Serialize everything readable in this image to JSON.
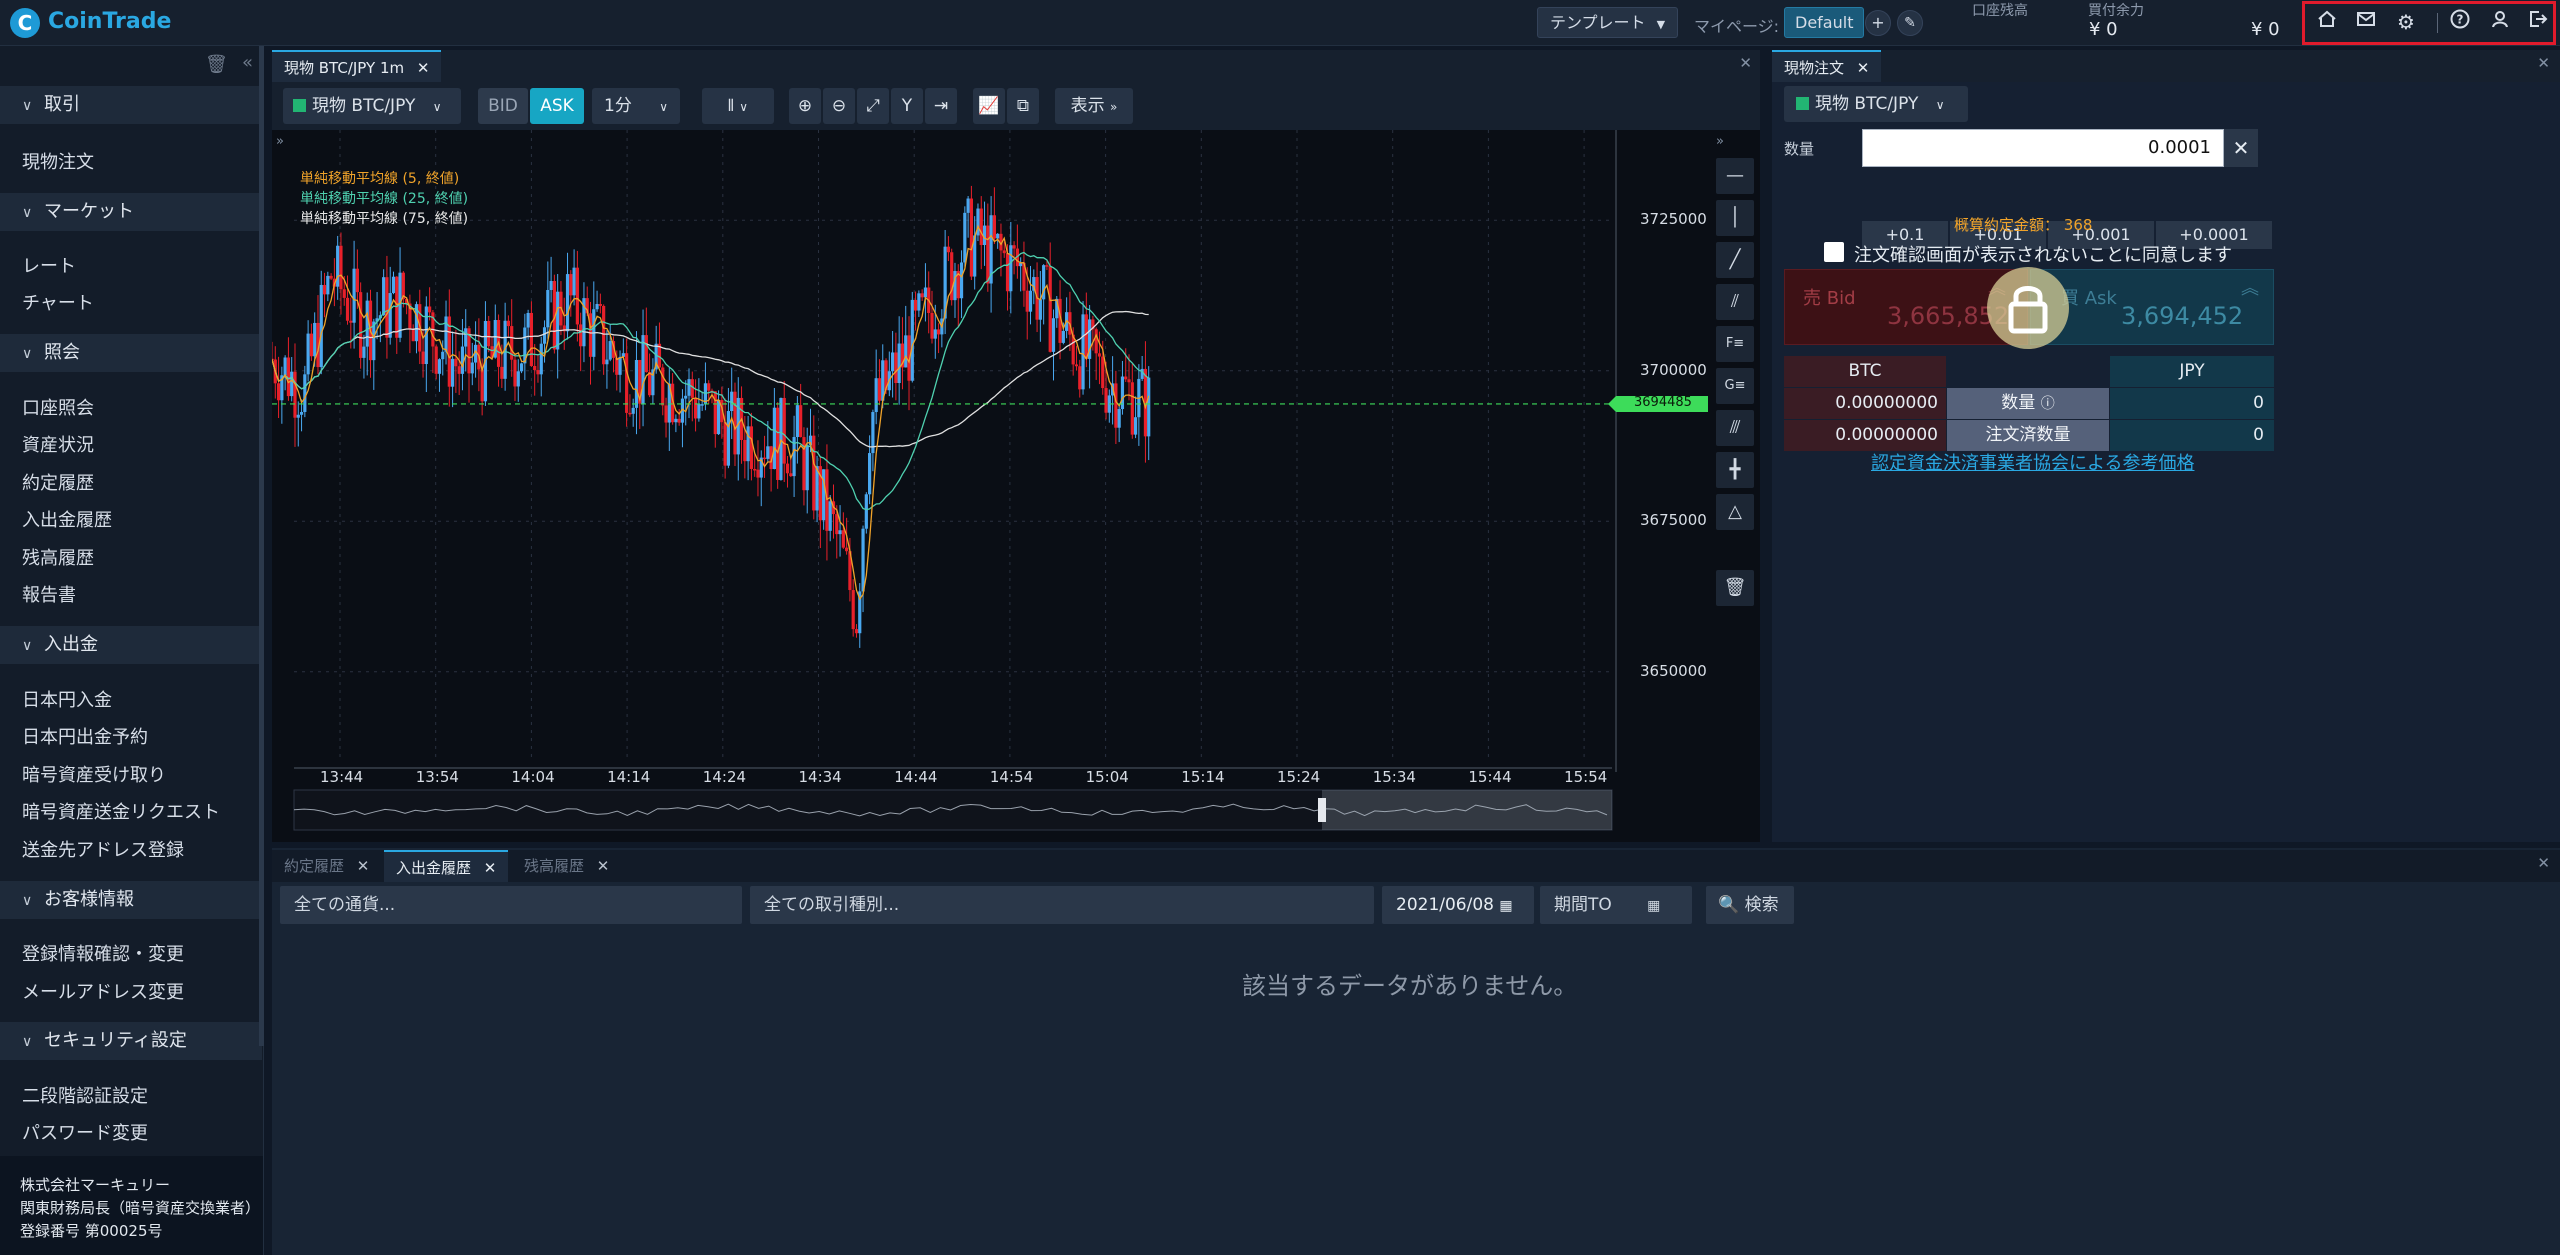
{
  "header": {
    "logo_mark": "C",
    "logo_text": "CoinTrade",
    "template_button": "テンプレート",
    "mypage_label": "マイページ:",
    "mypage_value": "Default",
    "balance_label": "口座残高",
    "balance_value": "¥ 0",
    "buying_power_label": "買付余力",
    "buying_power_value": "¥ 0",
    "icons": [
      "home-icon",
      "mail-icon",
      "gear-icon",
      "help-icon",
      "user-icon",
      "logout-icon"
    ]
  },
  "sidebar": {
    "sections": [
      {
        "title": "取引",
        "items": [
          "現物注文"
        ]
      },
      {
        "title": "マーケット",
        "items": [
          "レート",
          "チャート"
        ]
      },
      {
        "title": "照会",
        "items": [
          "口座照会",
          "資産状況",
          "約定履歴",
          "入出金履歴",
          "残高履歴",
          "報告書"
        ]
      },
      {
        "title": "入出金",
        "items": [
          "日本円入金",
          "日本円出金予約",
          "暗号資産受け取り",
          "暗号資産送金リクエスト",
          "送金先アドレス登録"
        ]
      },
      {
        "title": "お客様情報",
        "items": [
          "登録情報確認・変更",
          "メールアドレス変更"
        ]
      },
      {
        "title": "セキュリティ設定",
        "items": [
          "二段階認証設定",
          "パスワード変更"
        ]
      }
    ],
    "footer": {
      "company": "株式会社マーキュリー",
      "registrar": "関東財務局長（暗号資産交換業者）",
      "registration": "登録番号 第00025号"
    }
  },
  "chart_panel": {
    "tab_label": "現物 BTC/JPY 1m",
    "symbol": "現物 BTC/JPY",
    "bid_label": "BID",
    "ask_label": "ASK",
    "interval": "1分",
    "display_label": "表示",
    "legend": [
      {
        "label": "単純移動平均線 (5, 終値)",
        "color": "#f0a32a"
      },
      {
        "label": "単純移動平均線 (25, 終値)",
        "color": "#4fd1b0"
      },
      {
        "label": "単純移動平均線 (75, 終値)",
        "color": "#e8e8e8"
      }
    ],
    "price_tag": "3694485"
  },
  "chart_data": {
    "type": "candlestick",
    "ylim": [
      3635000,
      3740000
    ],
    "y_ticks": [
      "3725000",
      "3700000",
      "3675000",
      "3650000"
    ],
    "x_ticks": [
      "13:44",
      "13:54",
      "14:04",
      "14:14",
      "14:24",
      "14:34",
      "14:44",
      "14:54",
      "15:04",
      "15:14",
      "15:24",
      "15:34",
      "15:44",
      "15:54"
    ],
    "current_price": 3694485,
    "up_color": "#4aa8f0",
    "down_color": "#e8202a"
  },
  "order_panel": {
    "tab_label": "現物注文",
    "symbol": "現物 BTC/JPY",
    "qty_label": "数量",
    "qty_value": "0.0001",
    "increments": [
      "+0.1",
      "+0.01",
      "+0.001",
      "+0.0001"
    ],
    "estimate_label": "概算約定金額：",
    "estimate_value": "368",
    "confirm_label": "注文確認画面が表示されないことに同意します",
    "sell_label": "売 Bid",
    "sell_price": "3,665,852",
    "buy_label": "買 Ask",
    "buy_price": "3,694,452",
    "btc_header": "BTC",
    "jpy_header": "JPY",
    "rows": [
      {
        "label": "数量",
        "btc": "0.00000000",
        "jpy": "0"
      },
      {
        "label": "注文済数量",
        "btc": "0.00000000",
        "jpy": "0"
      }
    ],
    "ref_link": "認定資金決済事業者協会による参考価格"
  },
  "history_panel": {
    "tabs": [
      "約定履歴",
      "入出金履歴",
      "残高履歴"
    ],
    "currency_placeholder": "全ての通貨...",
    "type_placeholder": "全ての取引種別...",
    "date_from": "2021/06/08",
    "date_to": "期間TO",
    "search_label": "検索",
    "empty_message": "該当するデータがありません。"
  }
}
